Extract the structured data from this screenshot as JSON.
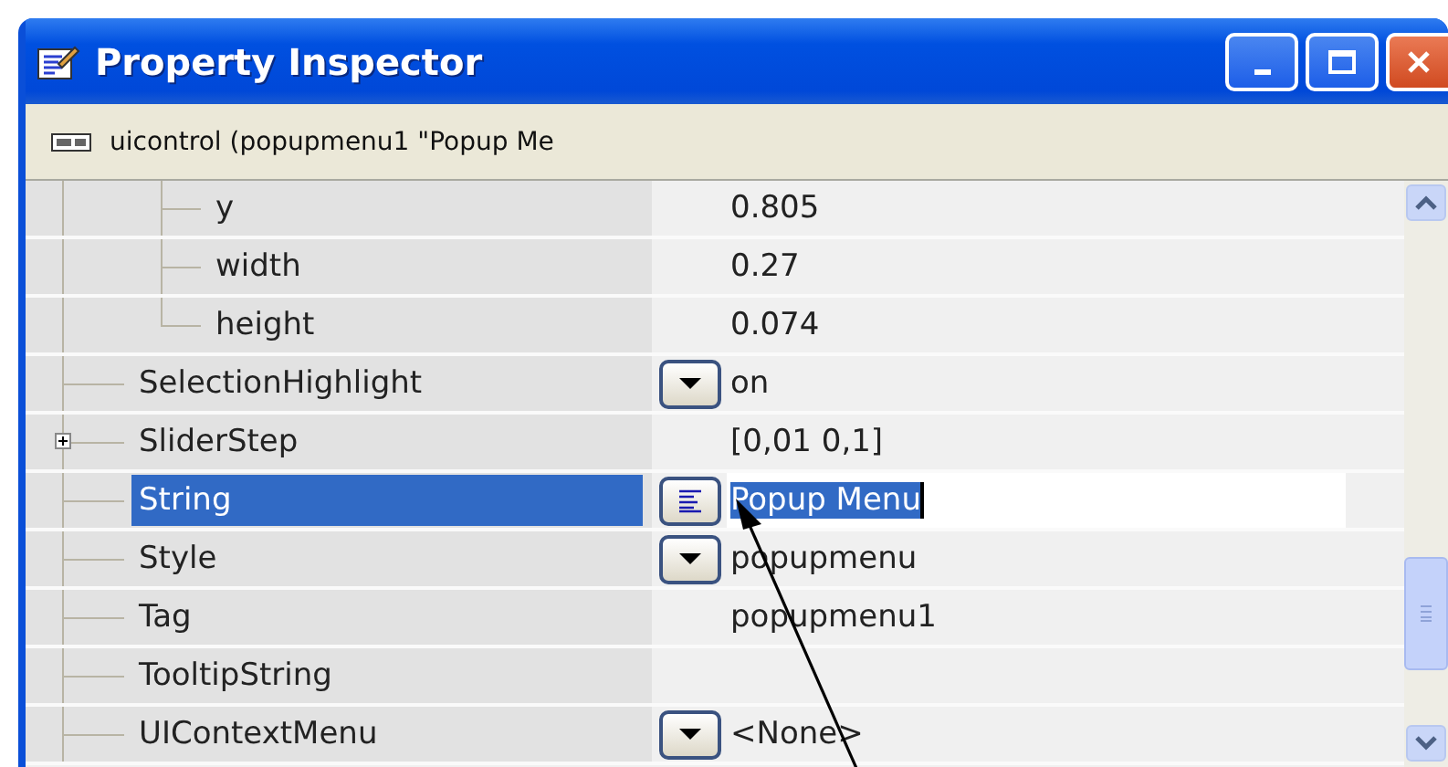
{
  "window": {
    "title": "Property Inspector"
  },
  "object_label": "uicontrol (popupmenu1 \"Popup Me",
  "properties": [
    {
      "kind": "group",
      "children": [
        {
          "name": "y",
          "value": "0.805",
          "selected": false,
          "expandable": false
        },
        {
          "name": "width",
          "value": "0.27",
          "selected": false,
          "expandable": false
        },
        {
          "name": "height",
          "value": "0.074",
          "selected": false,
          "expandable": false
        }
      ]
    },
    {
      "name": "SelectionHighlight",
      "value": "on",
      "kind": "dropdown",
      "selected": false,
      "expandable": false
    },
    {
      "name": "SliderStep",
      "value": "[0,01 0,1]",
      "kind": "plain",
      "selected": false,
      "expandable": true
    },
    {
      "name": "String",
      "value": "Popup Menu",
      "kind": "text",
      "selected": true,
      "expandable": false
    },
    {
      "name": "Style",
      "value": "popupmenu",
      "kind": "dropdown",
      "selected": false,
      "expandable": false
    },
    {
      "name": "Tag",
      "value": "popupmenu1",
      "kind": "plain",
      "selected": false,
      "expandable": false
    },
    {
      "name": "TooltipString",
      "kind": "plain",
      "selected": false,
      "expandable": false
    },
    {
      "name": "UIContextMenu",
      "value": "<None>",
      "kind": "dropdown",
      "selected": false,
      "expandable": false
    }
  ]
}
